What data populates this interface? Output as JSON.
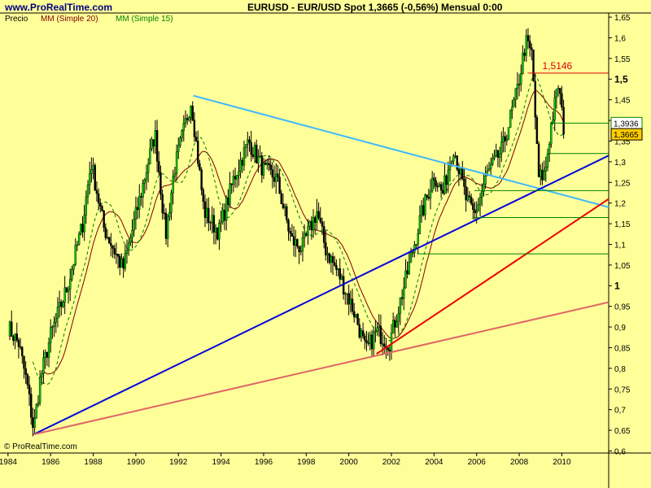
{
  "header": {
    "site": "www.ProRealTime.com",
    "title": "EURUSD - EUR/USD Spot    1,3665 (-0,56%)    Mensual  0:00"
  },
  "legend": [
    {
      "label": "Precio",
      "color": "#000000"
    },
    {
      "label": "MM (Simple 20)",
      "color": "#800000"
    },
    {
      "label": "MM (Simple 15)",
      "color": "#008000"
    }
  ],
  "copyright": "© ProRealTime.com",
  "colors": {
    "background": "#ffff99",
    "candle_up": "#00cc00",
    "candle_down": "#000000",
    "trend_light_blue": "#3fb8ff",
    "trend_dark_blue": "#0000dd",
    "trend_red": "#ee0000",
    "trend_pink": "#dd6666",
    "level_green": "#008000",
    "level_red": "#dd0000"
  },
  "chart_data": {
    "type": "candlestick",
    "symbol": "EURUSD",
    "timeframe": "Mensual",
    "xlim": [
      1983.7,
      2012.2
    ],
    "ylim": [
      0.595,
      1.66
    ],
    "x_ticks": [
      "1984",
      "1986",
      "1988",
      "1990",
      "1992",
      "1994",
      "1996",
      "1998",
      "2000",
      "2002",
      "2004",
      "2006",
      "2008",
      "2010"
    ],
    "y_ticks": [
      "1,65",
      "1,6",
      "1,55",
      "1,5",
      "1,45",
      "1,4",
      "1,35",
      "1,3",
      "1,25",
      "1,2",
      "1,15",
      "1,1",
      "1,05",
      "1",
      "0,95",
      "0,9",
      "0,85",
      "0,8",
      "0,75",
      "0,7",
      "0,65",
      "0,6"
    ],
    "y_ticks_bold": [
      "1,5",
      "1"
    ],
    "price_path": [
      [
        1984.0,
        0.9
      ],
      [
        1984.5,
        0.86
      ],
      [
        1984.9,
        0.76
      ],
      [
        1985.2,
        0.65
      ],
      [
        1985.5,
        0.77
      ],
      [
        1986.0,
        0.88
      ],
      [
        1986.8,
        1.0
      ],
      [
        1987.5,
        1.15
      ],
      [
        1987.9,
        1.3
      ],
      [
        1988.5,
        1.14
      ],
      [
        1989.4,
        1.04
      ],
      [
        1990.0,
        1.17
      ],
      [
        1990.9,
        1.37
      ],
      [
        1991.4,
        1.12
      ],
      [
        1991.8,
        1.28
      ],
      [
        1992.6,
        1.45
      ],
      [
        1993.2,
        1.18
      ],
      [
        1993.9,
        1.13
      ],
      [
        1994.6,
        1.26
      ],
      [
        1995.3,
        1.35
      ],
      [
        1996.0,
        1.28
      ],
      [
        1996.6,
        1.26
      ],
      [
        1997.3,
        1.11
      ],
      [
        1997.8,
        1.09
      ],
      [
        1998.5,
        1.18
      ],
      [
        1998.9,
        1.09
      ],
      [
        1999.6,
        1.02
      ],
      [
        2000.3,
        0.93
      ],
      [
        2000.8,
        0.84
      ],
      [
        2001.3,
        0.89
      ],
      [
        2001.9,
        0.86
      ],
      [
        2002.6,
        1.0
      ],
      [
        2003.4,
        1.17
      ],
      [
        2004.0,
        1.27
      ],
      [
        2004.4,
        1.22
      ],
      [
        2004.9,
        1.34
      ],
      [
        2005.5,
        1.21
      ],
      [
        2005.9,
        1.17
      ],
      [
        2006.5,
        1.27
      ],
      [
        2007.2,
        1.33
      ],
      [
        2007.9,
        1.47
      ],
      [
        2008.3,
        1.59
      ],
      [
        2008.6,
        1.56
      ],
      [
        2008.9,
        1.26
      ],
      [
        2009.2,
        1.27
      ],
      [
        2009.5,
        1.39
      ],
      [
        2009.85,
        1.49
      ],
      [
        2010.05,
        1.39
      ],
      [
        2010.15,
        1.3665
      ]
    ],
    "moving_averages": [
      {
        "name": "MM (Simple 20)",
        "period": 20,
        "color": "#800000",
        "dashed": false
      },
      {
        "name": "MM (Simple 15)",
        "period": 15,
        "color": "#008000",
        "dashed": true
      }
    ],
    "trendlines": [
      {
        "color": "#3fb8ff",
        "from": [
          1992.7,
          1.46
        ],
        "to": [
          2012.2,
          1.19
        ]
      },
      {
        "color": "#0000dd",
        "from": [
          1985.2,
          0.64
        ],
        "to": [
          2012.2,
          1.315
        ]
      },
      {
        "color": "#ee0000",
        "from": [
          2001.3,
          0.835
        ],
        "to": [
          2012.2,
          1.21
        ]
      },
      {
        "color": "#dd6666",
        "from": [
          1985.2,
          0.64
        ],
        "to": [
          2012.2,
          0.96
        ]
      }
    ],
    "horizontal_levels": [
      {
        "value": 1.5146,
        "from_x": 2008.4,
        "color": "#dd0000",
        "label": "1,5146"
      },
      {
        "value": 1.3936,
        "from_x": 2009.5,
        "color": "#008000"
      },
      {
        "value": 1.32,
        "from_x": 2009.3,
        "color": "#008000"
      },
      {
        "value": 1.23,
        "from_x": 2005.9,
        "color": "#008000"
      },
      {
        "value": 1.165,
        "from_x": 2005.8,
        "color": "#008000"
      },
      {
        "value": 1.077,
        "from_x": 2003.2,
        "color": "#008000"
      }
    ],
    "price_tags": [
      {
        "label": "1,3936",
        "value": 1.3936,
        "bg": "#ffffff",
        "border": "#008000"
      },
      {
        "label": "1,3665",
        "value": 1.3665,
        "bg": "#ffcc00",
        "border": "#000000"
      }
    ]
  }
}
